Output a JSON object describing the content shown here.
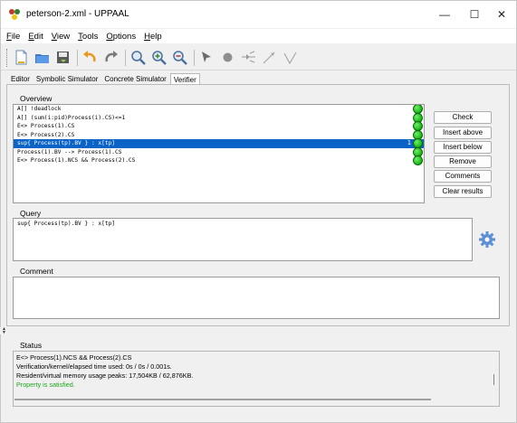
{
  "window": {
    "title": "peterson-2.xml - UPPAAL",
    "minimize": "—",
    "maximize": "☐",
    "close": "✕"
  },
  "menu": [
    {
      "label": "File",
      "mnemonic": "F",
      "rest": "ile"
    },
    {
      "label": "Edit",
      "mnemonic": "E",
      "rest": "dit"
    },
    {
      "label": "View",
      "mnemonic": "V",
      "rest": "iew"
    },
    {
      "label": "Tools",
      "mnemonic": "T",
      "rest": "ools"
    },
    {
      "label": "Options",
      "mnemonic": "O",
      "rest": "ptions"
    },
    {
      "label": "Help",
      "mnemonic": "H",
      "rest": "elp"
    }
  ],
  "toolbar": {
    "icons": [
      "new-icon",
      "open-icon",
      "save-icon",
      "undo-icon",
      "redo-icon",
      "zoom-fit-icon",
      "zoom-in-icon",
      "zoom-out-icon",
      "select-icon",
      "location-icon",
      "branch-icon",
      "edge-icon",
      "nail-icon"
    ]
  },
  "tabs": [
    "Editor",
    "Symbolic Simulator",
    "Concrete Simulator",
    "Verifier"
  ],
  "active_tab": "Verifier",
  "verifier": {
    "overview_label": "Overview",
    "queries": [
      {
        "text": "A[] !deadlock",
        "status": "satisfied",
        "selected": false,
        "tick": ""
      },
      {
        "text": "A[] (sum(i:pid)Process(i).CS)<=1",
        "status": "satisfied",
        "selected": false,
        "tick": ""
      },
      {
        "text": "E<> Process(1).CS",
        "status": "satisfied",
        "selected": false,
        "tick": ""
      },
      {
        "text": "E<> Process(2).CS",
        "status": "satisfied",
        "selected": false,
        "tick": ""
      },
      {
        "text": "sup{ Process(tp).BV } : x[tp]",
        "status": "satisfied",
        "selected": true,
        "tick": "1"
      },
      {
        "text": "Process(1).BV --> Process(1).CS",
        "status": "satisfied",
        "selected": false,
        "tick": ""
      },
      {
        "text": "E<> Process(1).NCS && Process(2).CS",
        "status": "satisfied",
        "selected": false,
        "tick": ""
      }
    ],
    "buttons": {
      "check": "Check",
      "insert_above": "Insert above",
      "insert_below": "Insert below",
      "remove": "Remove",
      "comments": "Comments",
      "clear_results": "Clear results"
    },
    "query_label": "Query",
    "query_text": "sup{ Process(tp).BV } : x[tp]",
    "comment_label": "Comment",
    "comment_text": "",
    "status_label": "Status",
    "status_lines": [
      "E<> Process(1).NCS && Process(2).CS",
      "Verification/kernel/elapsed time used: 0s / 0s / 0.001s.",
      "Resident/virtual memory usage peaks: 17,504KB / 62,876KB."
    ],
    "status_result": "Property is satisfied."
  },
  "colors": {
    "selection": "#0a64c8",
    "satisfied": "#1ea51e",
    "gear": "#5b8fd6"
  }
}
